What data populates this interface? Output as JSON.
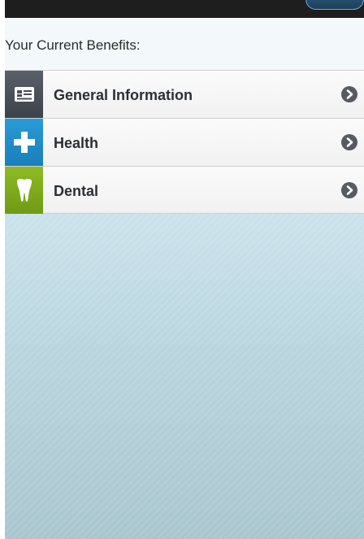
{
  "header": {
    "title": "Your Current Benefits:"
  },
  "benefits": [
    {
      "label": "General Information",
      "icon": "id-card-icon",
      "color": "#4a5058"
    },
    {
      "label": "Health",
      "icon": "medical-cross-icon",
      "color": "#238dca"
    },
    {
      "label": "Dental",
      "icon": "tooth-icon",
      "color": "#7faa1c"
    }
  ],
  "icons": {
    "row_action": "chevron-right-icon"
  }
}
